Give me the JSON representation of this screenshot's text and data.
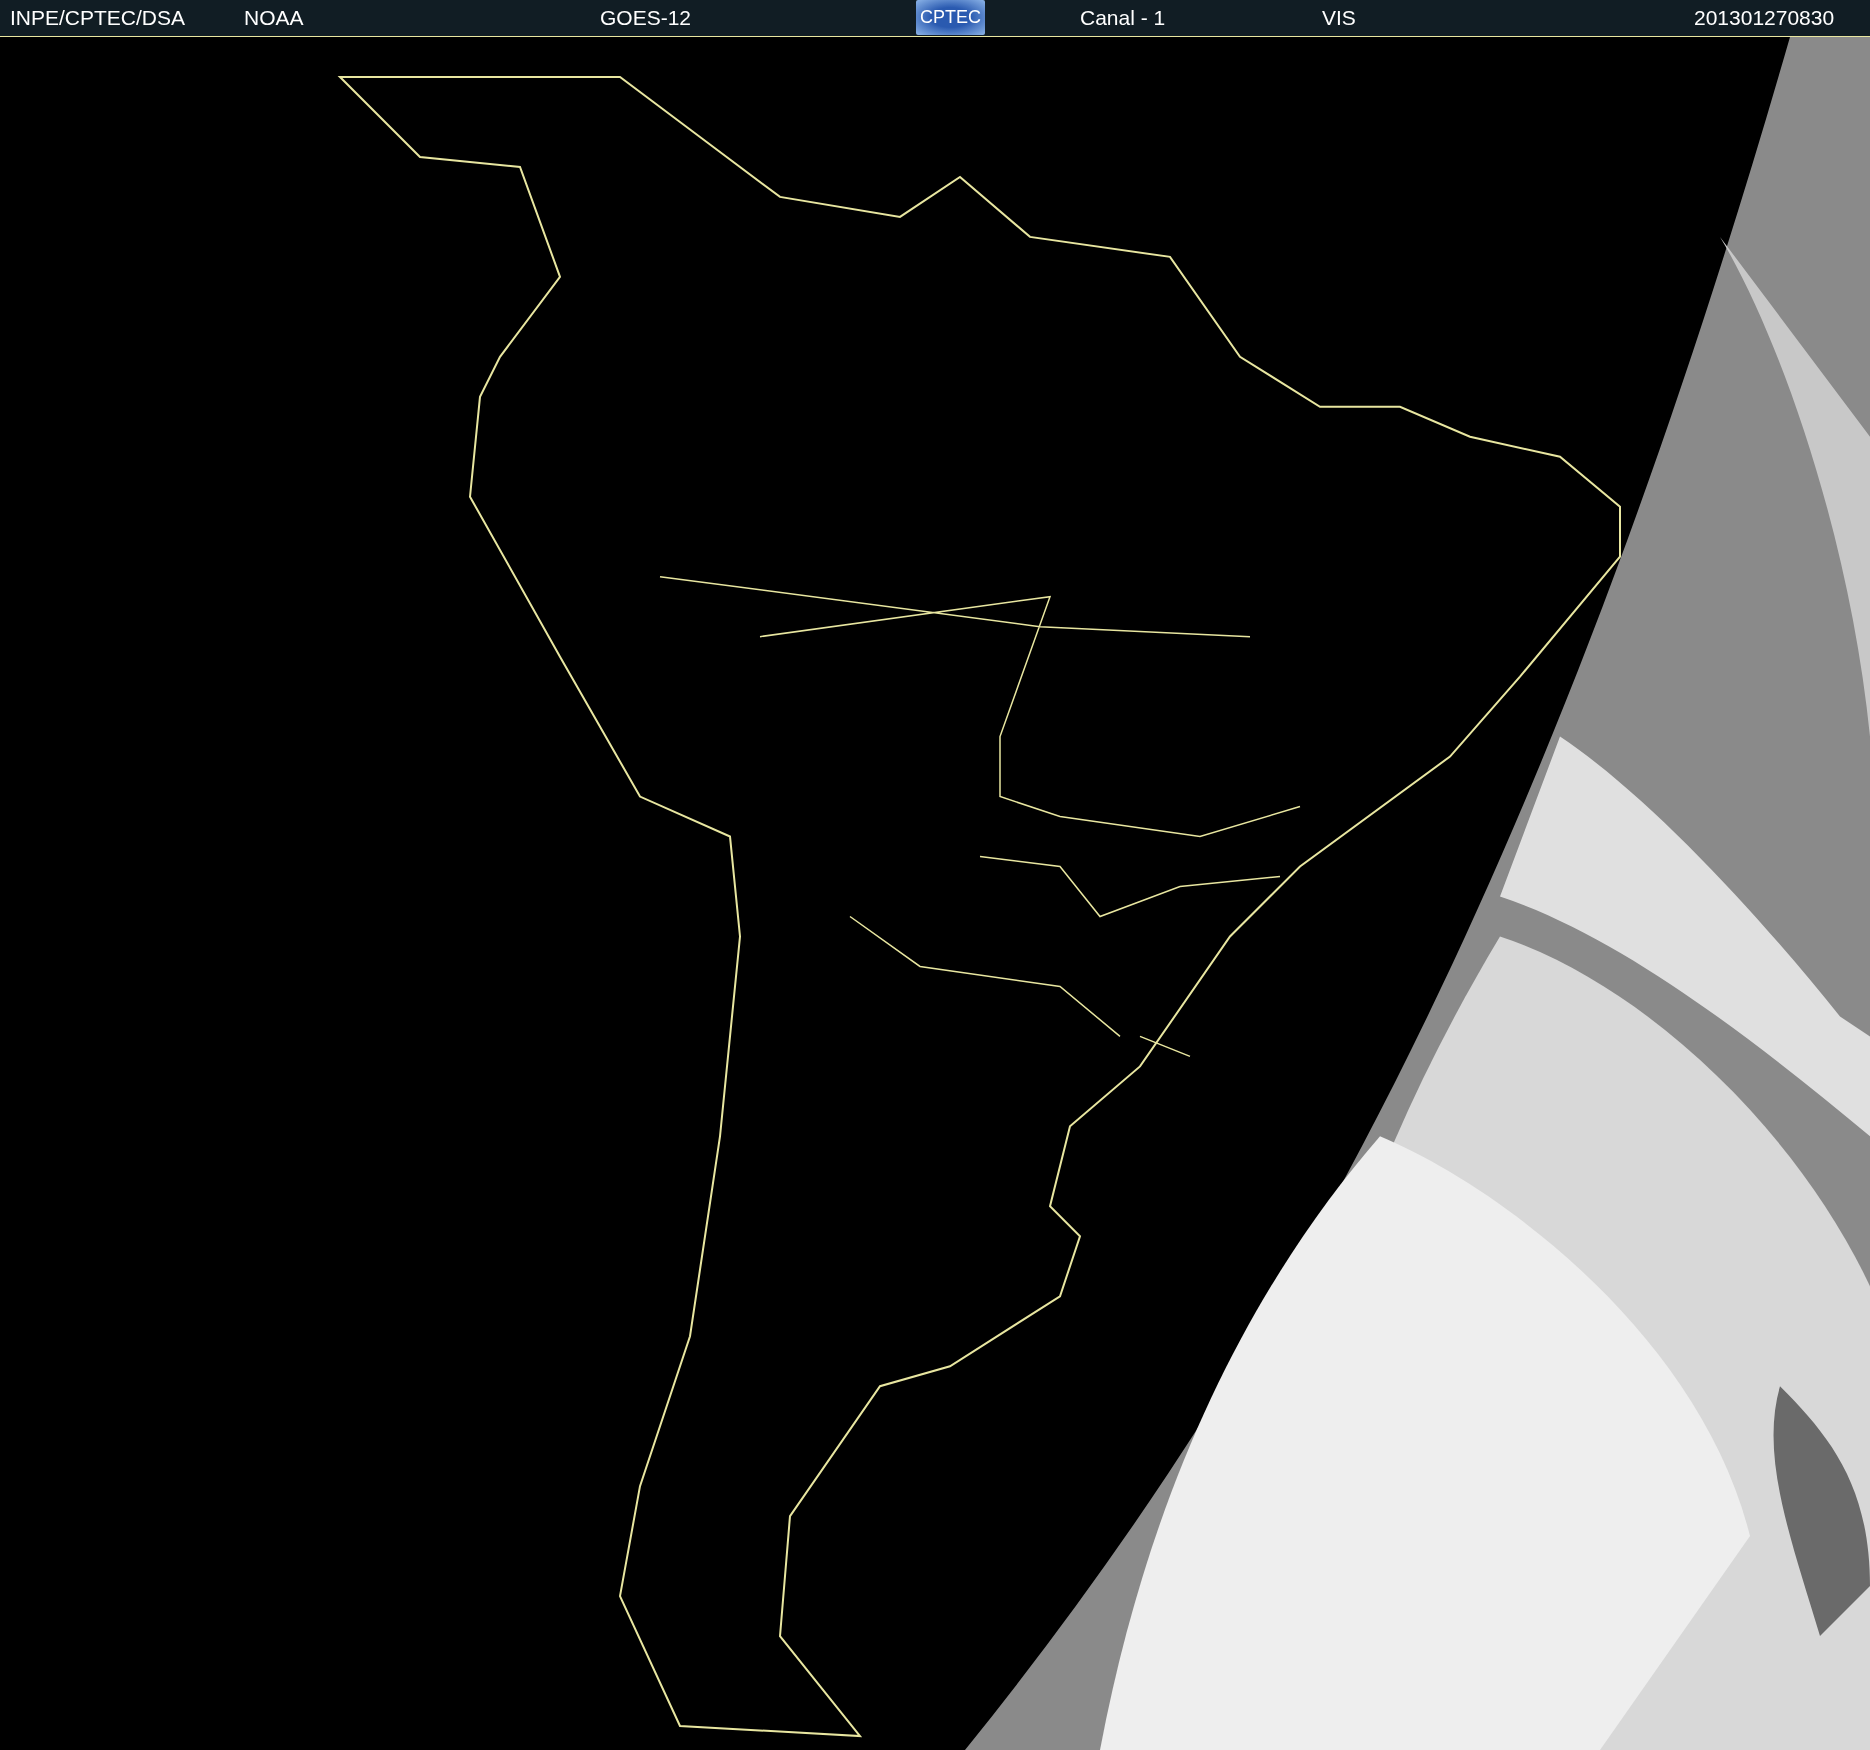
{
  "header": {
    "source": "INPE/CPTEC/DSA",
    "agency": "NOAA",
    "satellite": "GOES-12",
    "logo": "CPTEC",
    "channel": "Canal - 1",
    "band": "VIS",
    "timestamp": "201301270830"
  }
}
